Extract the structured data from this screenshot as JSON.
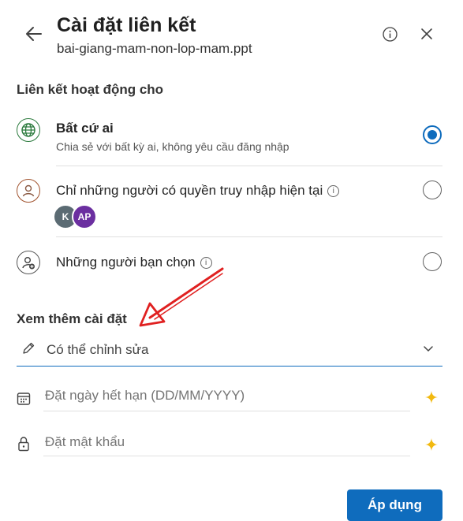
{
  "header": {
    "title": "Cài đặt liên kết",
    "filename": "bai-giang-mam-non-lop-mam.ppt"
  },
  "access_section": {
    "title": "Liên kết hoạt động cho",
    "options": [
      {
        "label": "Bất cứ ai",
        "description": "Chia sẻ với bất kỳ ai, không yêu cầu đăng nhập",
        "selected": true
      },
      {
        "label": "Chỉ những người có quyền truy nhập hiện tại",
        "selected": false,
        "avatars": [
          "K",
          "AP"
        ]
      },
      {
        "label": "Những người bạn chọn",
        "selected": false
      }
    ]
  },
  "more_settings": {
    "title": "Xem thêm cài đặt",
    "permission_value": "Có thể chỉnh sửa",
    "expiration_placeholder": "Đặt ngày hết hạn (DD/MM/YYYY)",
    "password_placeholder": "Đặt mật khẩu"
  },
  "apply_label": "Áp dụng",
  "colors": {
    "accent": "#0f6cbd",
    "arrow": "#e02020",
    "premium": "#f2b90f",
    "avatar_k": "#5b6b73",
    "avatar_ap": "#6b2fa0"
  }
}
